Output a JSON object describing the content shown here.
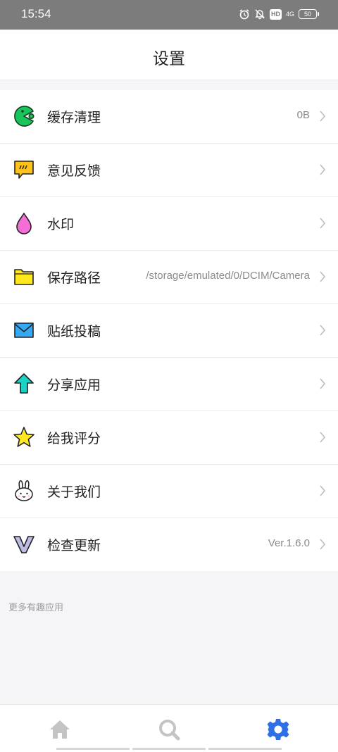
{
  "status_bar": {
    "time": "15:54",
    "hd": "HD",
    "network": "4G",
    "battery": "50"
  },
  "header": {
    "title": "设置"
  },
  "settings": [
    {
      "label": "缓存清理",
      "value": "0B",
      "icon": "pacman-icon"
    },
    {
      "label": "意见反馈",
      "value": "",
      "icon": "feedback-chat-icon"
    },
    {
      "label": "水印",
      "value": "",
      "icon": "water-drop-icon"
    },
    {
      "label": "保存路径",
      "value": "/storage/emulated/0/DCIM/Camera",
      "icon": "folder-icon"
    },
    {
      "label": "贴纸投稿",
      "value": "",
      "icon": "envelope-icon"
    },
    {
      "label": "分享应用",
      "value": "",
      "icon": "share-arrow-icon"
    },
    {
      "label": "给我评分",
      "value": "",
      "icon": "star-icon"
    },
    {
      "label": "关于我们",
      "value": "",
      "icon": "bunny-icon"
    },
    {
      "label": "检查更新",
      "value": "Ver.1.6.0",
      "icon": "v-logo-icon"
    }
  ],
  "more_section": {
    "label": "更多有趣应用"
  },
  "bottom_nav": {
    "items": [
      "home-icon",
      "search-icon",
      "settings-gear-icon"
    ],
    "active": "settings-gear-icon",
    "active_color": "#2f6fe8",
    "inactive_color": "#c4c4c4"
  }
}
